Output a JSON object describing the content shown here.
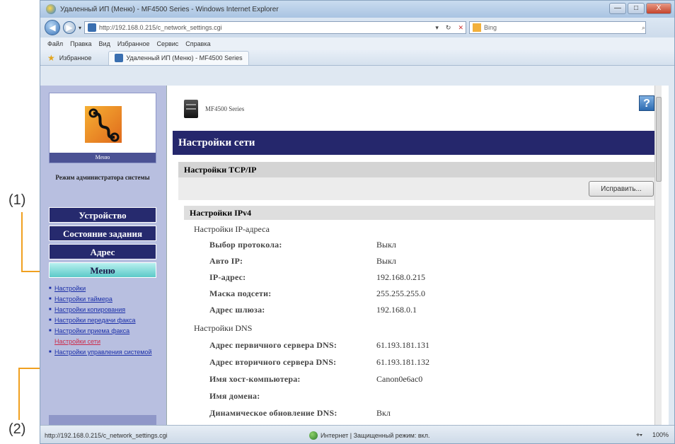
{
  "callouts": {
    "one": "(1)",
    "two": "(2)"
  },
  "browser": {
    "title": "Удаленный ИП (Меню) - MF4500 Series - Windows Internet Explorer",
    "window_buttons": {
      "minimize": "—",
      "maximize": "□",
      "close": "X"
    },
    "address": "http://192.168.0.215/c_network_settings.cgi",
    "address_tools": {
      "dropdown": "▾",
      "refresh": "↻",
      "stop": "✕"
    },
    "search_placeholder": "Bing",
    "search_icon": "⌕",
    "menu": [
      "Файл",
      "Правка",
      "Вид",
      "Избранное",
      "Сервис",
      "Справка"
    ],
    "favorites_label": "Избранное",
    "tab_title": "Удаленный ИП (Меню) - MF4500 Series"
  },
  "left_nav": {
    "logo_caption": "Меню",
    "admin_mode": "Режим администратора системы",
    "buttons": [
      "Устройство",
      "Состояние задания",
      "Адрес",
      "Меню"
    ],
    "active_button": "Меню",
    "links": [
      "Настройки",
      "Настройки таймера",
      "Настройки копирования",
      "Настройки передачи факса",
      "Настройки приема факса",
      "Настройки сети",
      "Настройки управления системой"
    ],
    "current_link": "Настройки сети"
  },
  "main": {
    "model": "MF4500 Series",
    "help": "?",
    "page_title": "Настройки сети",
    "section_title": "Настройки TCP/IP",
    "edit_button": "Исправить...",
    "ipv4_title": "Настройки IPv4",
    "ip_group": "Настройки IP-адреса",
    "ip_rows": [
      {
        "label": "Выбор протокола:",
        "value": "Выкл"
      },
      {
        "label": "Авто IP:",
        "value": "Выкл"
      },
      {
        "label": "IP-адрес:",
        "value": "192.168.0.215"
      },
      {
        "label": "Маска подсети:",
        "value": "255.255.255.0"
      },
      {
        "label": "Адрес шлюза:",
        "value": "192.168.0.1"
      }
    ],
    "dns_group": "Настройки DNS",
    "dns_rows": [
      {
        "label": "Адрес первичного сервера DNS:",
        "value": "61.193.181.131"
      },
      {
        "label": "Адрес вторичного сервера DNS:",
        "value": "61.193.181.132"
      },
      {
        "label": "Имя хост-компьютера:",
        "value": "Canon0e6ac0"
      },
      {
        "label": "Имя домена:",
        "value": ""
      },
      {
        "label": "Динамическое обновление DNS:",
        "value": "Вкл"
      }
    ]
  },
  "status_bar": {
    "url": "http://192.168.0.215/c_network_settings.cgi",
    "zone": "Интернет | Защищенный режим: вкл.",
    "zoom": "100%",
    "zoom_icon": "⌖▾"
  },
  "colors": {
    "nav_dark": "#262a6e",
    "nav_active": "#5cc9c8",
    "nav_bg": "#b8bfe0",
    "header_bg": "#25276c",
    "callout_line": "#f0a020"
  }
}
